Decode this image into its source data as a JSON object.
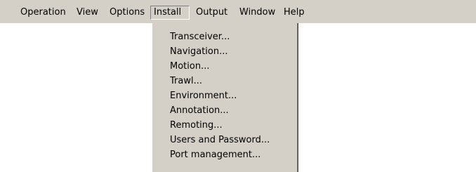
{
  "menubar": {
    "items": [
      {
        "label": "Operation"
      },
      {
        "label": "View"
      },
      {
        "label": "Options"
      },
      {
        "label": "Install",
        "open": true
      },
      {
        "label": "Output"
      },
      {
        "label": "Window"
      },
      {
        "label": "Help"
      }
    ]
  },
  "install_menu": {
    "items": [
      {
        "label": "Transceiver..."
      },
      {
        "label": "Navigation..."
      },
      {
        "label": "Motion..."
      },
      {
        "label": "Trawl..."
      },
      {
        "label": "Environment..."
      },
      {
        "label": "Annotation..."
      },
      {
        "label": "Remoting..."
      },
      {
        "label": "Users and Password..."
      },
      {
        "label": "Port management..."
      }
    ]
  }
}
